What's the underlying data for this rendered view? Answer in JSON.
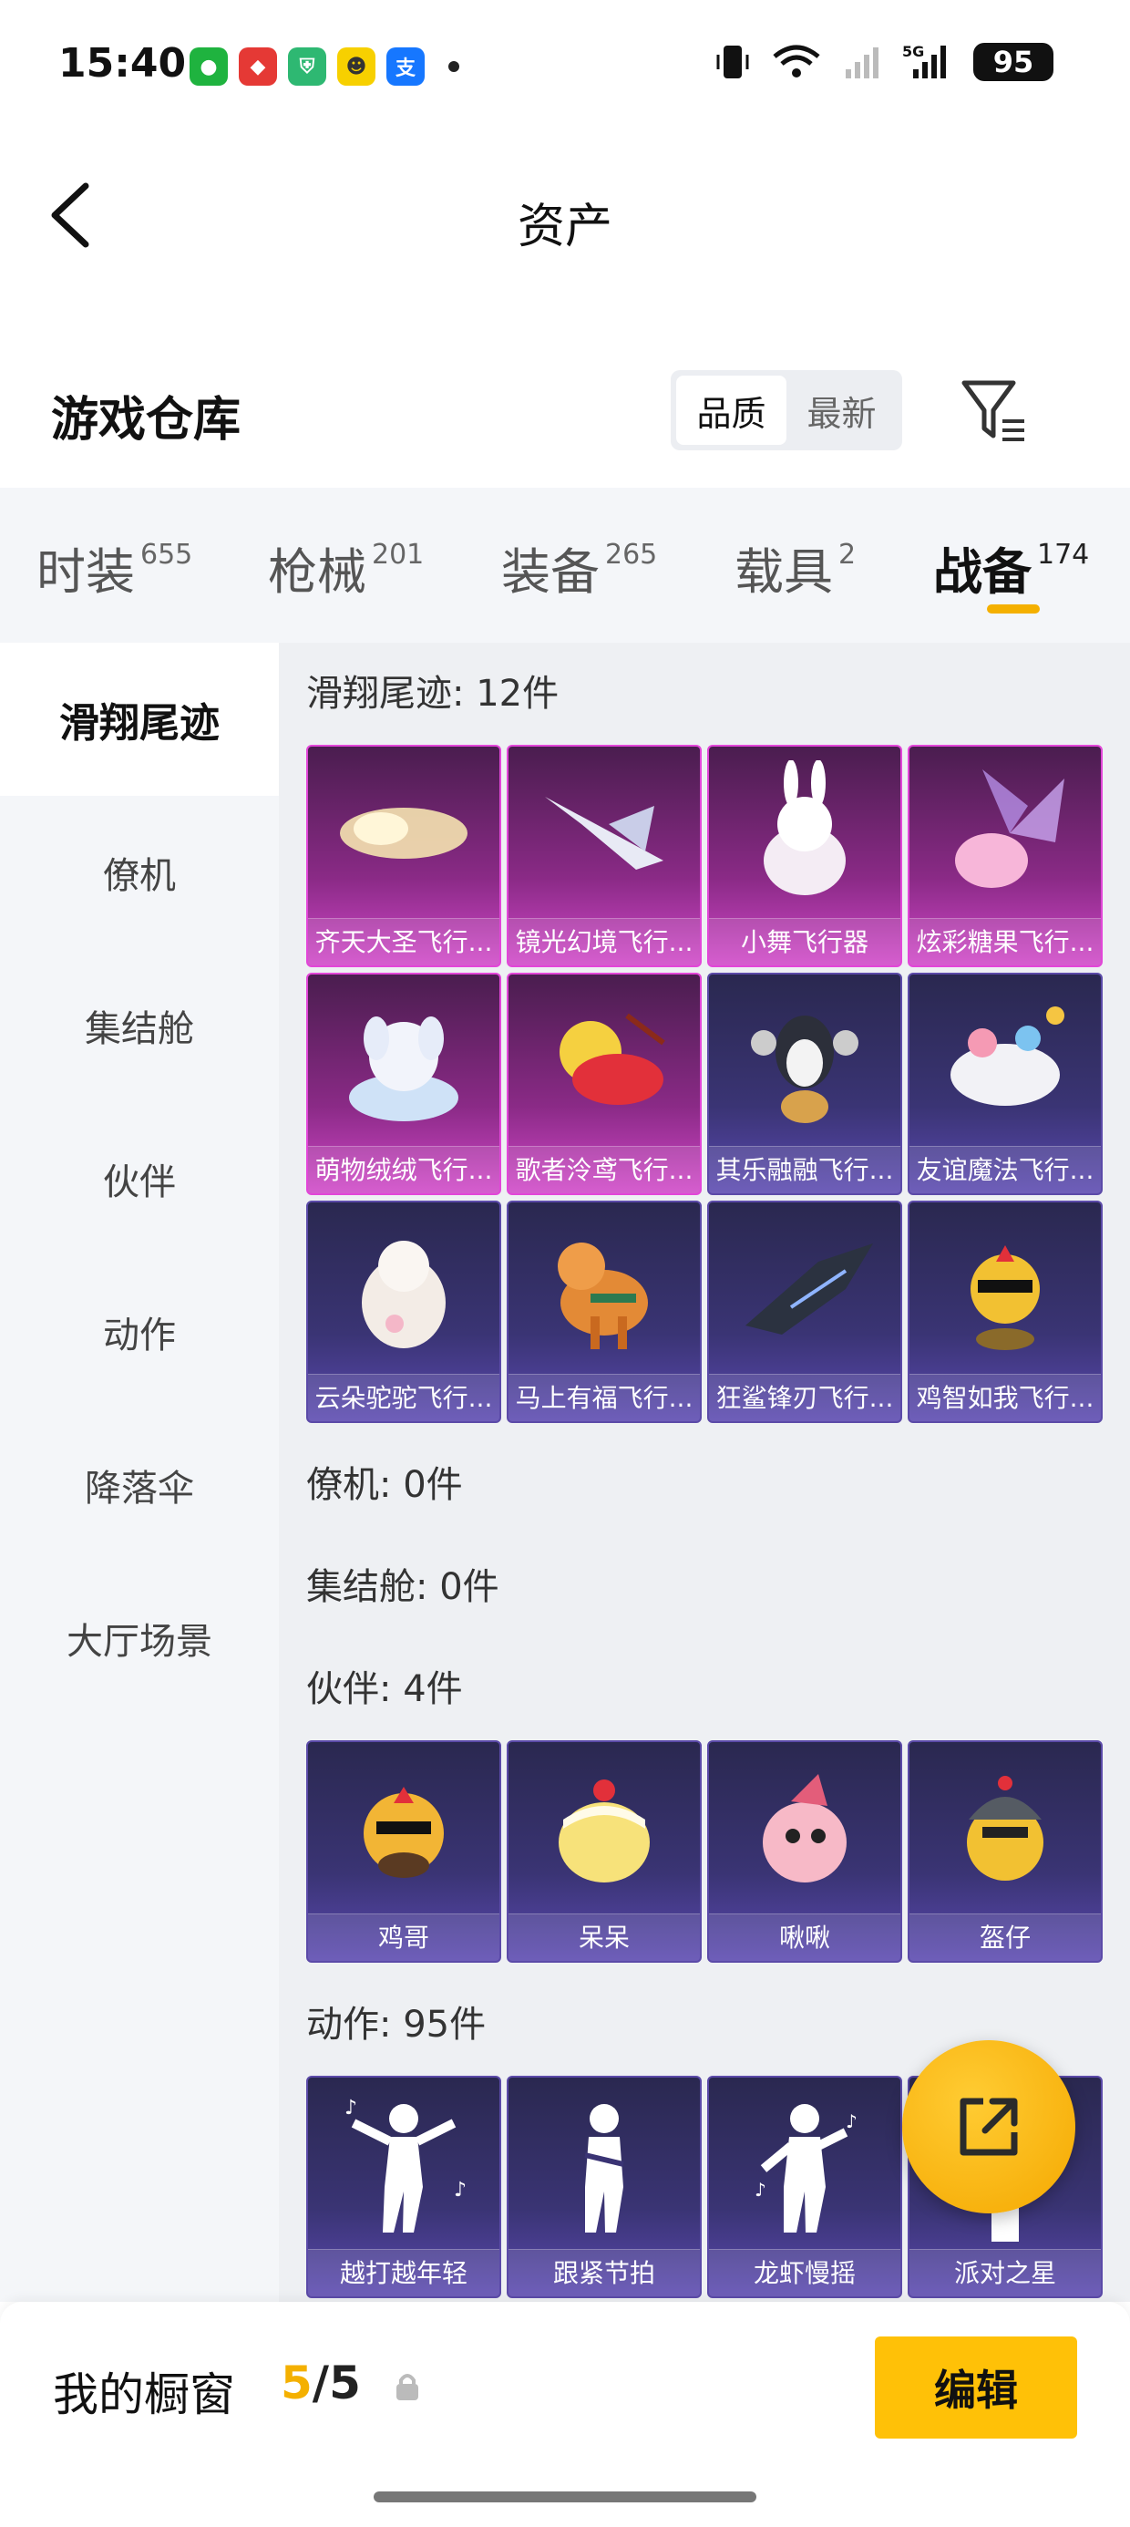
{
  "status": {
    "time": "15:40",
    "battery": "95",
    "network": "5G"
  },
  "nav": {
    "title": "资产"
  },
  "warehouse": {
    "title": "游戏仓库",
    "sort": [
      "品质",
      "最新"
    ]
  },
  "tabs": [
    {
      "label": "时装",
      "count": "655"
    },
    {
      "label": "枪械",
      "count": "201"
    },
    {
      "label": "装备",
      "count": "265"
    },
    {
      "label": "载具",
      "count": "2"
    },
    {
      "label": "战备",
      "count": "174"
    }
  ],
  "sidebar": [
    "滑翔尾迹",
    "僚机",
    "集结舱",
    "伙伴",
    "动作",
    "降落伞",
    "大厅场景"
  ],
  "sections": {
    "glide": {
      "title": "滑翔尾迹: 12件",
      "items": [
        "齐天大圣飞行...",
        "镜光幻境飞行...",
        "小舞飞行器",
        "炫彩糖果飞行...",
        "萌物绒绒飞行...",
        "歌者泠鸢飞行...",
        "其乐融融飞行...",
        "友谊魔法飞行...",
        "云朵驼驼飞行...",
        "马上有福飞行...",
        "狂鲨锋刃飞行...",
        "鸡智如我飞行..."
      ]
    },
    "wingman": {
      "title": "僚机: 0件"
    },
    "pod": {
      "title": "集结舱: 0件"
    },
    "partner": {
      "title": "伙伴: 4件",
      "items": [
        "鸡哥",
        "呆呆",
        "啾啾",
        "盔仔"
      ]
    },
    "emote": {
      "title": "动作: 95件",
      "items": [
        "越打越年轻",
        "跟紧节拍",
        "龙虾慢摇",
        "派对之星"
      ]
    }
  },
  "bottom": {
    "showcase_label": "我的橱窗",
    "current": "5",
    "total": "5",
    "edit_label": "编辑"
  },
  "colors": {
    "accent": "#f4b000",
    "legendary": "#e246d8",
    "epic": "#5b4aa8"
  }
}
